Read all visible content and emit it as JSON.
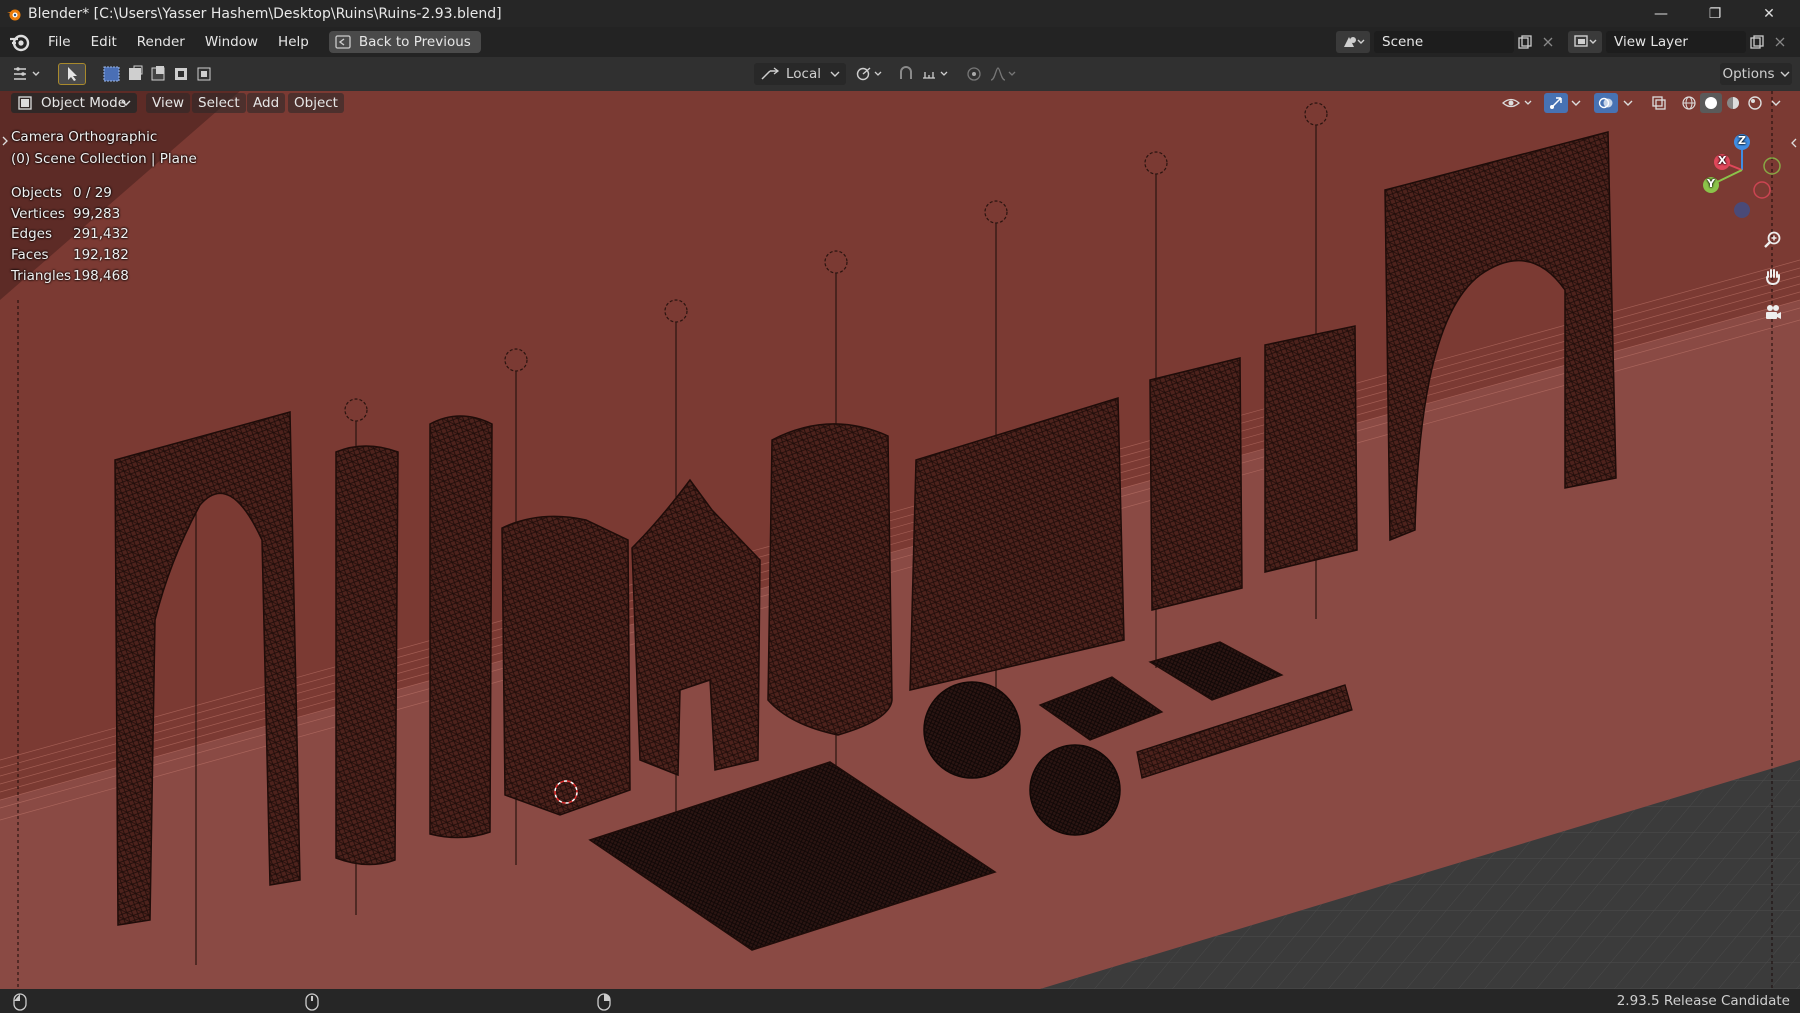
{
  "window": {
    "title": "Blender* [C:\\Users\\Yasser Hashem\\Desktop\\Ruins\\Ruins-2.93.blend]",
    "minimize_glyph": "—",
    "restore_glyph": "❐",
    "close_glyph": "✕"
  },
  "menubar": {
    "items": [
      "File",
      "Edit",
      "Render",
      "Window",
      "Help"
    ],
    "back_button": "Back to Previous",
    "scene_label": "Scene",
    "view_layer_label": "View Layer"
  },
  "toolbar": {
    "transform_orientation": "Local",
    "options_label": "Options"
  },
  "viewport_header": {
    "mode": "Object Mode",
    "menus": [
      "View",
      "Select",
      "Add",
      "Object"
    ]
  },
  "overlay": {
    "view_name": "Camera Orthographic",
    "collection": "(0) Scene Collection | Plane",
    "stats": [
      {
        "label": "Objects",
        "value": "0 / 29"
      },
      {
        "label": "Vertices",
        "value": "99,283"
      },
      {
        "label": "Edges",
        "value": "291,432"
      },
      {
        "label": "Faces",
        "value": "192,182"
      },
      {
        "label": "Triangles",
        "value": "198,468"
      }
    ]
  },
  "gizmo": {
    "x_label": "X",
    "y_label": "Y",
    "z_label": "Z"
  },
  "statusbar": {
    "version": "2.93.5 Release Candidate"
  },
  "colors": {
    "background_red": "#7a3a32",
    "mesh_dark": "#3a1c17",
    "axis_x": "#e0475a",
    "axis_y": "#8bc34a",
    "axis_z": "#3f8de3"
  },
  "icons": [
    "blender-logo-icon",
    "back-icon",
    "scene-icon",
    "view-layer-icon",
    "editor-type-icon",
    "select-box-icon",
    "transform-orientation-icon",
    "pivot-icon",
    "snap-icon",
    "proportional-edit-icon",
    "visibility-icon",
    "gizmo-icon",
    "overlay-icon",
    "xray-icon",
    "wireframe-shading-icon",
    "solid-shading-icon",
    "material-shading-icon",
    "rendered-shading-icon",
    "zoom-icon",
    "pan-icon",
    "camera-icon",
    "mouse-icon"
  ]
}
